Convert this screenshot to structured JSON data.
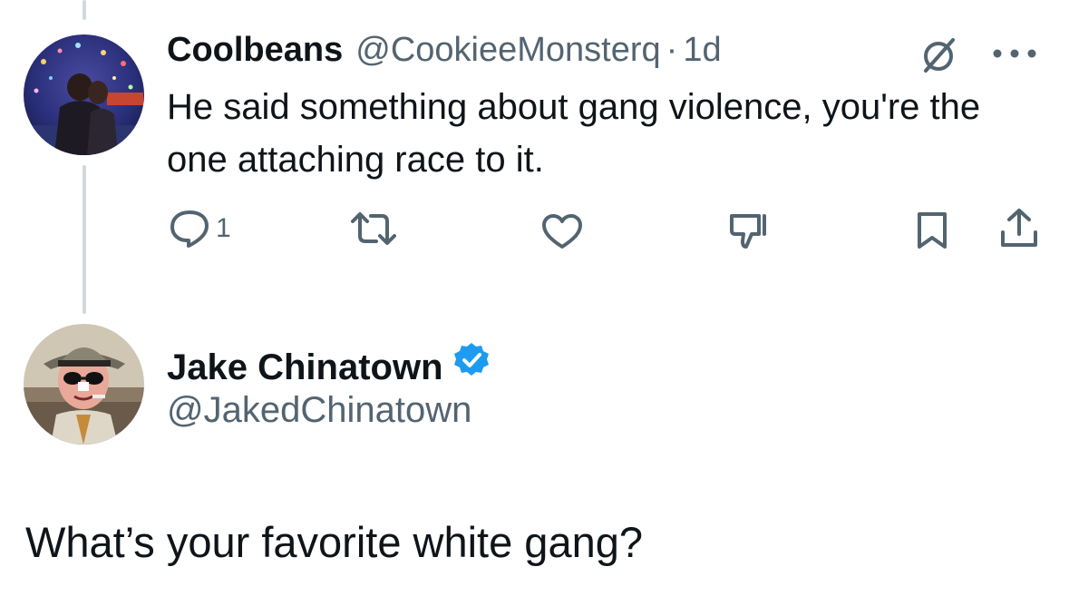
{
  "thread_tweet": {
    "display_name": "Coolbeans",
    "handle": "@CookieeMonsterq",
    "separator": "·",
    "time": "1d",
    "text": "He said something about gang violence, you're the one attaching race to it.",
    "reply_count": "1"
  },
  "main_tweet": {
    "display_name": "Jake Chinatown",
    "handle": "@JakedChinatown",
    "verified": true,
    "text": "What’s your favorite white gang?"
  },
  "colors": {
    "text": "#0f1419",
    "secondary": "#536471",
    "thread_line": "#cfd9de",
    "verified_badge": "#1d9bf0"
  }
}
